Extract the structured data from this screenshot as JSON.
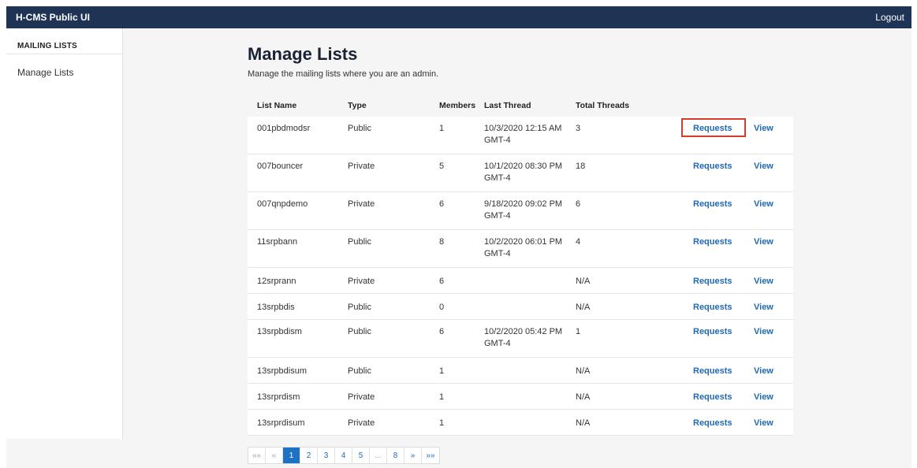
{
  "app": {
    "title": "H-CMS Public UI",
    "logout": "Logout"
  },
  "sidebar": {
    "heading": "MAILING LISTS",
    "items": [
      {
        "label": "Manage Lists"
      }
    ]
  },
  "page": {
    "title": "Manage Lists",
    "subtitle": "Manage the mailing lists where you are an admin."
  },
  "table": {
    "headers": {
      "name": "List Name",
      "type": "Type",
      "members": "Members",
      "last": "Last Thread",
      "total": "Total Threads"
    },
    "rows": [
      {
        "name": "001pbdmodsr",
        "type": "Public",
        "members": "1",
        "last": "10/3/2020 12:15 AM GMT-4",
        "total": "3",
        "requests": "Requests",
        "view": "View"
      },
      {
        "name": "007bouncer",
        "type": "Private",
        "members": "5",
        "last": "10/1/2020 08:30 PM GMT-4",
        "total": "18",
        "requests": "Requests",
        "view": "View"
      },
      {
        "name": "007qnpdemo",
        "type": "Private",
        "members": "6",
        "last": "9/18/2020 09:02 PM GMT-4",
        "total": "6",
        "requests": "Requests",
        "view": "View"
      },
      {
        "name": "11srpbann",
        "type": "Public",
        "members": "8",
        "last": "10/2/2020 06:01 PM GMT-4",
        "total": "4",
        "requests": "Requests",
        "view": "View"
      },
      {
        "name": "12srprann",
        "type": "Private",
        "members": "6",
        "last": "",
        "total": "N/A",
        "requests": "Requests",
        "view": "View"
      },
      {
        "name": "13srpbdis",
        "type": "Public",
        "members": "0",
        "last": "",
        "total": "N/A",
        "requests": "Requests",
        "view": "View"
      },
      {
        "name": "13srpbdism",
        "type": "Public",
        "members": "6",
        "last": "10/2/2020 05:42 PM GMT-4",
        "total": "1",
        "requests": "Requests",
        "view": "View"
      },
      {
        "name": "13srpbdisum",
        "type": "Public",
        "members": "1",
        "last": "",
        "total": "N/A",
        "requests": "Requests",
        "view": "View"
      },
      {
        "name": "13srprdism",
        "type": "Private",
        "members": "1",
        "last": "",
        "total": "N/A",
        "requests": "Requests",
        "view": "View"
      },
      {
        "name": "13srprdisum",
        "type": "Private",
        "members": "1",
        "last": "",
        "total": "N/A",
        "requests": "Requests",
        "view": "View"
      }
    ]
  },
  "pagination": {
    "first": "«« ",
    "prev": "«",
    "pages": [
      "1",
      "2",
      "3",
      "4",
      "5",
      "...",
      "8"
    ],
    "next": "»",
    "last": "»»",
    "current": "1"
  },
  "colors": {
    "topbar": "#1f3354",
    "link": "#2169b3",
    "highlight": "#d93a2b",
    "active_page": "#1e72c2"
  }
}
